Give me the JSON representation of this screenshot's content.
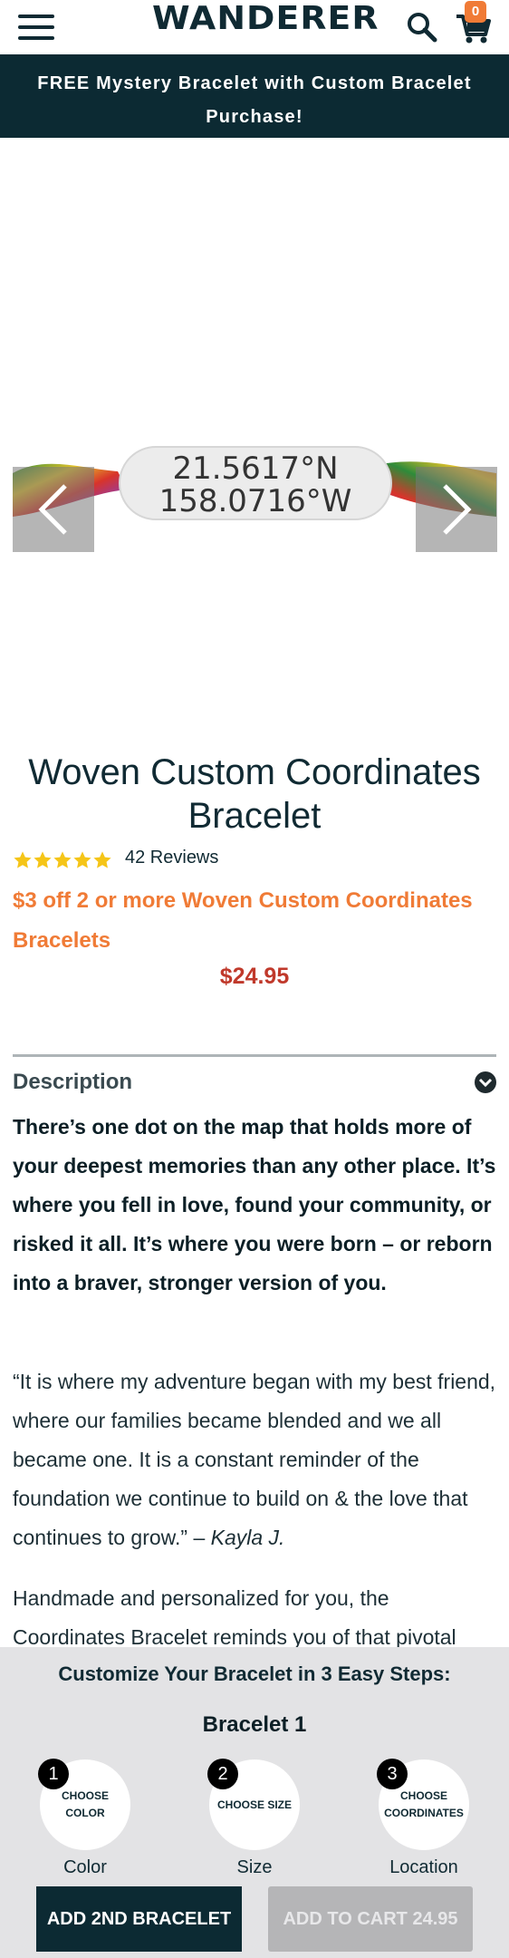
{
  "header": {
    "brand": "WANDERER",
    "menu_icon": "hamburger-menu-icon",
    "search_icon": "search-icon",
    "cart_icon": "shopping-cart-icon",
    "cart_count": "0"
  },
  "promo_banner": {
    "text": "FREE Mystery Bracelet with Custom Bracelet Purchase!"
  },
  "carousel": {
    "image_text_line1": "21.5617°N",
    "image_text_line2": "158.0716°W",
    "prev_icon": "chevron-left-icon",
    "next_icon": "chevron-right-icon"
  },
  "product": {
    "title": "Woven Custom Coordinates Bracelet",
    "rating": 5,
    "rating_max": 5,
    "reviews_label": "42 Reviews",
    "promo": "$3 off 2 or more Woven Custom Coordinates Bracelets",
    "price": "$24.95"
  },
  "description": {
    "heading": "Description",
    "lead": "There’s one dot on the map that holds more of your deepest memories than any other place. It’s where you fell in love, found your community, or risked it all. It’s where you were born – or reborn into a braver, stronger version of you.",
    "quote": "“It is where my adventure began with my best friend, where our families became blended and we all became one. It is a constant reminder of the foundation we continue to build on & the love that continues to grow.” –",
    "quote_author": "Kayla J.",
    "more": "Handmade and personalized for you, the Coordinates Bracelet reminds you of that pivotal"
  },
  "customizer": {
    "heading": "Customize Your Bracelet in 3 Easy Steps:",
    "bracelet_label": "Bracelet 1",
    "steps": [
      {
        "number": "1",
        "text": "CHOOSE COLOR",
        "caption": "Color"
      },
      {
        "number": "2",
        "text": "CHOOSE SIZE",
        "caption": "Size"
      },
      {
        "number": "3",
        "text": "CHOOSE COORDINATES",
        "caption": "Location"
      }
    ],
    "add_second_label": "ADD 2ND BRACELET",
    "add_to_cart_label": "ADD TO CART 24.95"
  },
  "colors": {
    "navy": "#0c2a33",
    "accent_orange": "#f07b36",
    "price_red": "#c0392b",
    "star_gold": "#f5c518",
    "panel_gray": "#e3e3e5",
    "disabled_gray": "#b5b5b7"
  }
}
